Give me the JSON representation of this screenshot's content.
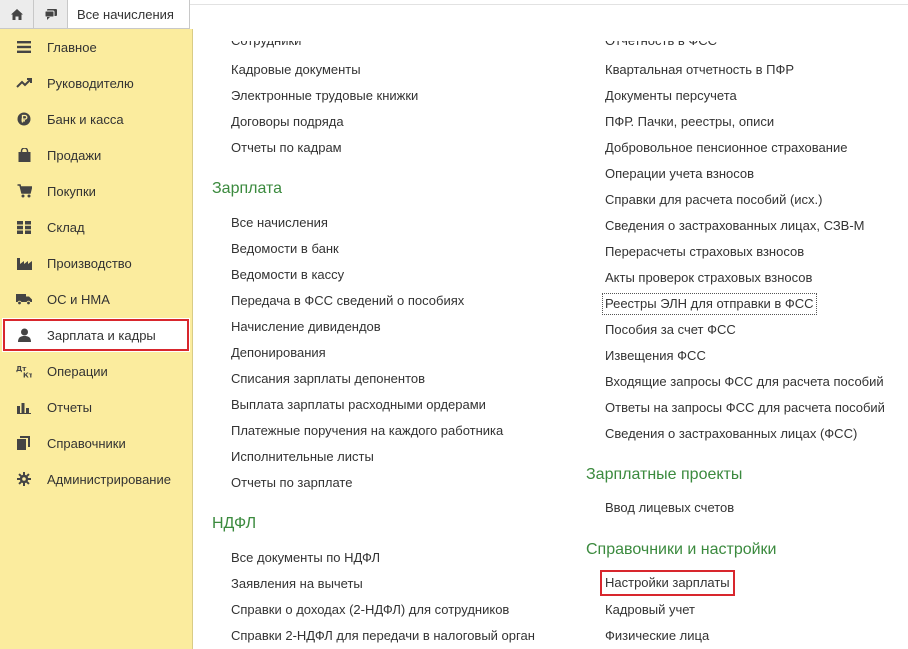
{
  "topbar": {
    "tab_label": "Все начисления"
  },
  "sidebar": {
    "items": [
      {
        "label": "Главное",
        "icon": "menu-icon"
      },
      {
        "label": "Руководителю",
        "icon": "trend-icon"
      },
      {
        "label": "Банк и касса",
        "icon": "ruble-coin-icon"
      },
      {
        "label": "Продажи",
        "icon": "shopping-bag-icon"
      },
      {
        "label": "Покупки",
        "icon": "cart-icon"
      },
      {
        "label": "Склад",
        "icon": "warehouse-grid-icon"
      },
      {
        "label": "Производство",
        "icon": "factory-icon"
      },
      {
        "label": "ОС и НМА",
        "icon": "truck-icon"
      },
      {
        "label": "Зарплата и кадры",
        "icon": "person-icon"
      },
      {
        "label": "Операции",
        "icon": "debit-credit-icon"
      },
      {
        "label": "Отчеты",
        "icon": "bar-chart-icon"
      },
      {
        "label": "Справочники",
        "icon": "books-icon"
      },
      {
        "label": "Администрирование",
        "icon": "gear-icon"
      }
    ],
    "active_index": 8
  },
  "left_column": {
    "cut_top": "Сотрудники",
    "kadry_links": [
      "Кадровые документы",
      "Электронные трудовые книжки",
      "Договоры подряда",
      "Отчеты по кадрам"
    ],
    "salary_heading": "Зарплата",
    "salary_links": [
      "Все начисления",
      "Ведомости в банк",
      "Ведомости в кассу",
      "Передача в ФСС сведений о пособиях",
      "Начисление дивидендов",
      "Депонирования",
      "Списания зарплаты депонентов",
      "Выплата зарплаты расходными ордерами",
      "Платежные поручения на каждого работника",
      "Исполнительные листы",
      "Отчеты по зарплате"
    ],
    "ndfl_heading": "НДФЛ",
    "ndfl_links": [
      "Все документы по НДФЛ",
      "Заявления на вычеты",
      "Справки о доходах (2-НДФЛ) для сотрудников",
      "Справки 2-НДФЛ для передачи в налоговый орган"
    ]
  },
  "right_column": {
    "cut_top": "Отчетность в ФСС",
    "links": [
      "Квартальная отчетность в ПФР",
      "Документы персучета",
      "ПФР. Пачки, реестры, описи",
      "Добровольное пенсионное страхование",
      "Операции учета взносов",
      "Справки для расчета пособий (исх.)",
      "Сведения о застрахованных лицах, СЗВ-М",
      "Перерасчеты страховых взносов",
      "Акты проверок страховых взносов",
      "Реестры ЭЛН для отправки в ФСС",
      "Пособия за счет ФСС",
      "Извещения ФСС",
      "Входящие запросы ФСС для расчета пособий",
      "Ответы на запросы ФСС для расчета пособий",
      "Сведения о застрахованных лицах (ФСС)"
    ],
    "projects_heading": "Зарплатные проекты",
    "projects_links": [
      "Ввод лицевых счетов"
    ],
    "settings_heading": "Справочники и настройки",
    "settings_links": [
      "Настройки зарплаты",
      "Кадровый учет",
      "Физические лица"
    ]
  },
  "colors": {
    "sidebar_bg": "#fbec9e",
    "heading_green": "#3b8a3e",
    "highlight_red": "#d8262d"
  }
}
